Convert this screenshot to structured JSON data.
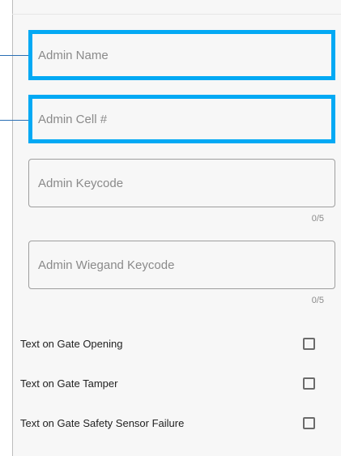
{
  "form": {
    "admin_name": {
      "value": "",
      "placeholder": "Admin Name"
    },
    "admin_cell": {
      "value": "",
      "placeholder": "Admin Cell #"
    },
    "admin_keycode": {
      "value": "",
      "placeholder": "Admin Keycode",
      "counter": "0/5"
    },
    "admin_wiegand": {
      "value": "",
      "placeholder": "Admin Wiegand Keycode",
      "counter": "0/5"
    }
  },
  "options": [
    {
      "label": "Text on Gate Opening",
      "checked": false
    },
    {
      "label": "Text on Gate Tamper",
      "checked": false
    },
    {
      "label": "Text on Gate Safety Sensor Failure",
      "checked": false
    }
  ],
  "colors": {
    "highlight": "#03a9f4",
    "callout": "#2a6fb4",
    "panel_bg": "#f7f7f7"
  }
}
